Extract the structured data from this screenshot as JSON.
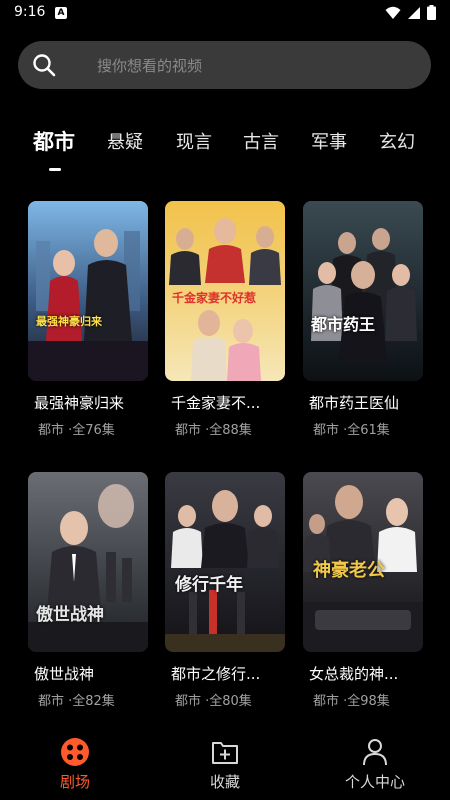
{
  "status_bar": {
    "time": "9:16",
    "notification_letter": "A"
  },
  "search": {
    "placeholder": "搜你想看的视频"
  },
  "tabs": [
    {
      "label": "都市",
      "active": true
    },
    {
      "label": "悬疑",
      "active": false
    },
    {
      "label": "现言",
      "active": false
    },
    {
      "label": "古言",
      "active": false
    },
    {
      "label": "军事",
      "active": false
    },
    {
      "label": "玄幻",
      "active": false
    }
  ],
  "dramas": [
    {
      "title": "最强神豪归来",
      "meta": "都市 ·全76集",
      "poster_text": "最强神豪归来"
    },
    {
      "title": "千金家妻不...",
      "meta": "都市 ·全88集",
      "poster_text": "千金家妻不好惹"
    },
    {
      "title": "都市药王医仙",
      "meta": "都市 ·全61集",
      "poster_text": "都市药王"
    },
    {
      "title": "傲世战神",
      "meta": "都市 ·全82集",
      "poster_text": "傲世战神"
    },
    {
      "title": "都市之修行...",
      "meta": "都市 ·全80集",
      "poster_text": "修行千年"
    },
    {
      "title": "女总裁的神...",
      "meta": "都市 ·全98集",
      "poster_text": "神豪老公"
    }
  ],
  "bottom_nav": [
    {
      "label": "剧场",
      "icon": "theater-icon",
      "active": true
    },
    {
      "label": "收藏",
      "icon": "collect-icon",
      "active": false
    },
    {
      "label": "个人中心",
      "icon": "user-icon",
      "active": false
    }
  ],
  "colors": {
    "accent": "#ff5a2c",
    "search_bg": "#3a3a3a",
    "background": "#000000"
  }
}
